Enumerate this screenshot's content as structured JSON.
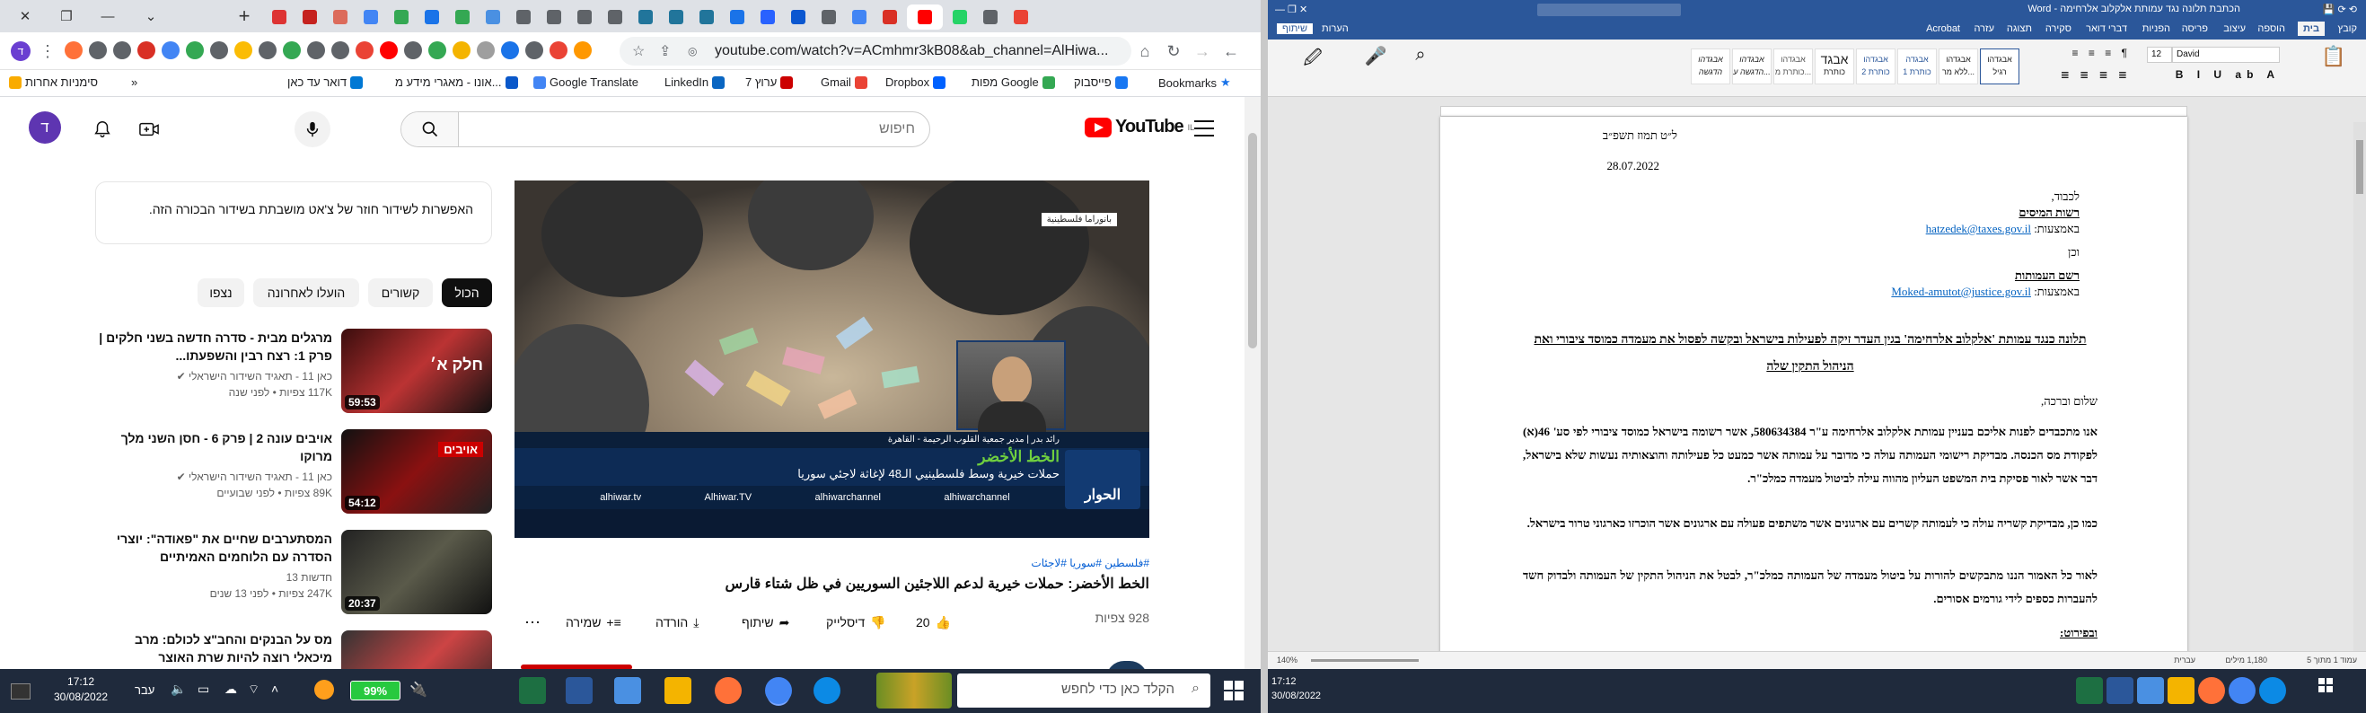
{
  "browser": {
    "tab_colors": [
      "#d33",
      "#c5221f",
      "#dc6b5b",
      "#4285f4",
      "#34a853",
      "#1a73e8",
      "#34a853",
      "#4a90e2",
      "#5f6368",
      "#5f6368",
      "#5f6368",
      "#5f6368",
      "#21759b",
      "#21759b",
      "#21759b",
      "#1a73e8",
      "#2962ff",
      "#0b57d0",
      "#5f6368",
      "#4285f4",
      "#d93025",
      "#ff0000",
      "#25d366",
      "#5f6368",
      "#ea4335"
    ],
    "url": "youtube.com/watch?v=ACmhmr3kB08&ab_channel=AlHiwa..."
  },
  "bookmarks": {
    "items": [
      "סימניות אחרות",
      "דואר עד כאן",
      "אונו - מאגרי מידע מ...",
      "Google Translate",
      "LinkedIn",
      "ערוץ 7",
      "Gmail",
      "מפות Google",
      "Dropbox",
      "פייסבוק",
      "Bookmarks"
    ]
  },
  "youtube": {
    "logo": "YouTube",
    "country": "IL",
    "avatar_letter": "ד",
    "search_placeholder": "חיפוש",
    "chat_notice": "האפשרות לשידור חוזר של צ'אט מושבתת בשידור הבכורה הזה.",
    "chips": [
      "הכול",
      "קשורים",
      "הועלו לאחרונה",
      "נצפו"
    ],
    "video": {
      "channel_tag": "بانوراما فلسطينية",
      "lower_banner": "الخط الأخضر",
      "lower_sub": "حملات خيرية وسط فلسطينيي الـ48 لإغاثة لاجئي سوريا",
      "speaker": "رائد بدر | مدير جمعية القلوب الرحيمة - القاهرة",
      "socials": [
        "alhiwar.tv",
        "Alhiwar.TV",
        "alhiwarchannel",
        "alhiwarchannel"
      ],
      "brand": "الحوار",
      "tags": "#فلسطين #سوريا #لاجئات",
      "title": "الخط الأخضر: حملات خيرية لدعم اللاجئين السوريين في ظل شتاء قارس",
      "views": "928 צפיות",
      "likes": "20",
      "dislike": "דיסלייק",
      "share": "שיתוף",
      "download": "הורדה",
      "save": "שמירה"
    },
    "recommendations": [
      {
        "title": "מרגלים מבית - סדרה חדשה בשני חלקים | פרק 1: רצח רבין והשפעתו...",
        "channel": "כאן 11 - תאגיד השידור הישראלי",
        "meta": "117K צפיות • לפני שנה",
        "duration": "59:53",
        "thumb_text": "חלק א׳"
      },
      {
        "title": "אויבים עונה 2 | פרק 6 - חסן השני מלך מרוקו",
        "channel": "כאן 11 - תאגיד השידור הישראלי",
        "meta": "89K צפיות • לפני שבועיים",
        "duration": "54:12",
        "thumb_text": "אויבים"
      },
      {
        "title": "המסתערבים שחיים את \"פאודה\": יוצרי הסדרה עם הלוחמים האמיתיים",
        "channel": "חדשות 13",
        "meta": "247K צפיות • לפני 13 שנים",
        "duration": "20:37",
        "thumb_text": ""
      },
      {
        "title": "מס על הבנקים והחב\"צ לכולם: מרב מיכאלי רוצה להיות שרת האוצר",
        "channel": "",
        "meta": "",
        "duration": "",
        "thumb_text": ""
      }
    ]
  },
  "taskbar": {
    "search_placeholder": "הקלד כאן כדי לחפש",
    "time": "17:12",
    "date": "30/08/2022",
    "lang": "עבר",
    "battery": "99%"
  },
  "word": {
    "title": "הכתבת תלונה נגד עמותת אלקלוב אלרחימה - Word",
    "tabs": [
      "קובץ",
      "בית",
      "הוספה",
      "עיצוב",
      "פריסה",
      "הפניות",
      "דברי דואר",
      "סקירה",
      "תצוגה",
      "עזרה",
      "Acrobat",
      "שיתוף",
      "הערות"
    ],
    "font": "David",
    "font_size": "12",
    "styles": [
      "אבגדהו",
      "אבגדהו",
      "אבגדה",
      "אבגדהו",
      "אבגד",
      "אבגדהו",
      "אבגדהו",
      "אבגדהו"
    ],
    "style_names": [
      "רגיל",
      "ללא מר...",
      "כותרת 1",
      "כותרת 2",
      "כותרת",
      "כותרת מ...",
      "הדגשה ע...",
      "הדגשה"
    ],
    "doc": {
      "hebrew_date": "ל״ט תמוז תשפ״ב",
      "date": "28.07.2022",
      "to": "לכבוד,",
      "recipient1": "רשות המיסים",
      "via1_label": "באמצעות:",
      "email1": "hatzedek@taxes.gov.il",
      "and": "וכן",
      "recipient2": "רשם העמותות",
      "via2_label": "באמצעות:",
      "email2": "Moked-amutot@justice.gov.il",
      "subject": "תלונה כנגד עמותת 'אלקלוב אלרחימה' בגין העדר זיקה לפעילות בישראל ובקשה לפסול את מעמדה כמוסד ציבורי ואת הניהול התקין שלה",
      "greeting": "שלום וברכה,",
      "para1": "אנו מתכבדים לפנות אליכם בעניין עמותת אלקלוב אלרחימה ע\"ר 580634384, אשר רשומה בישראל כמוסד ציבורי לפי סע' 46(א) לפקודת מס הכנסה. מבדיקת רישומי העמותה עולה כי מדובר על עמותה אשר כמעט כל פעילותה והוצאותיה נעשות שלא בישראל, דבר אשר לאור פסיקת בית המשפט העליון מהווה עילה לביטול מעמדה כמלכ\"ר.",
      "para2": "כמו כן, מבדיקת קשריה עולה כי לעמותה קשרים עם ארגונים אשר משתפים פעולה עם ארגונים אשר הוכרזו כארגוני טרור בישראל.",
      "para3": "לאור כל האמור הננו מתבקשים להורות על ביטול מעמדה של העמותה כמלכ\"ר, לבטל את הניהול התקין של העמותה ולבדוק חשד להעברות כספים לידי גורמים אסורים.",
      "details": "ובפירוט:"
    },
    "status": {
      "page": "עמוד 1 מתוך 5",
      "words": "1,180 מילים",
      "lang": "עברית",
      "zoom": "140%"
    }
  }
}
